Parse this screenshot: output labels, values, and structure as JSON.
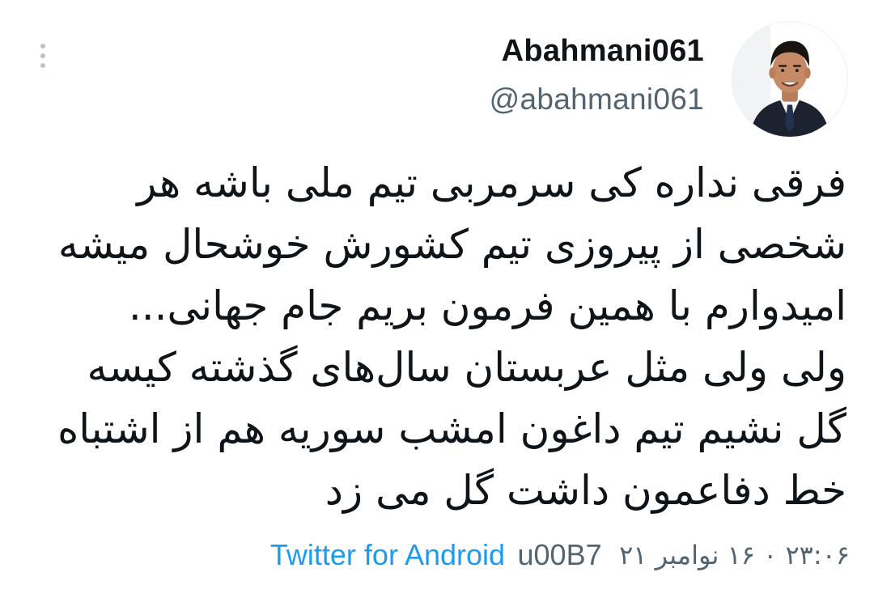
{
  "tweet": {
    "author": {
      "display_name": "Abahmani061",
      "handle": "@abahmani061",
      "avatar_icon": "profile-photo-icon"
    },
    "more_icon": "vertical-dots-icon",
    "body_lines": [
      "فرقی نداره کی  سرمربی تیم ملی  باشه هر",
      "شخصی از پیروزی تیم کشورش خوشحال میشه",
      "امیدوارم با همین فرمون بریم جام جهانی...",
      "ولی ولی مثل عربستان سال‌های گذشته کیسه",
      "گل نشیم تیم داغون امشب سوریه هم از اشتباه",
      "خط دفاعمون داشت گل می زد"
    ],
    "meta": {
      "datetime": "۲۳:۰۶ ۰ ۱۶ نوامبر ۲۱",
      "separator": "u00B7",
      "source": "Twitter for Android"
    },
    "colors": {
      "text_primary": "#0f1419",
      "text_secondary": "#536471",
      "link": "#1d9bf0",
      "background": "#ffffff"
    }
  }
}
